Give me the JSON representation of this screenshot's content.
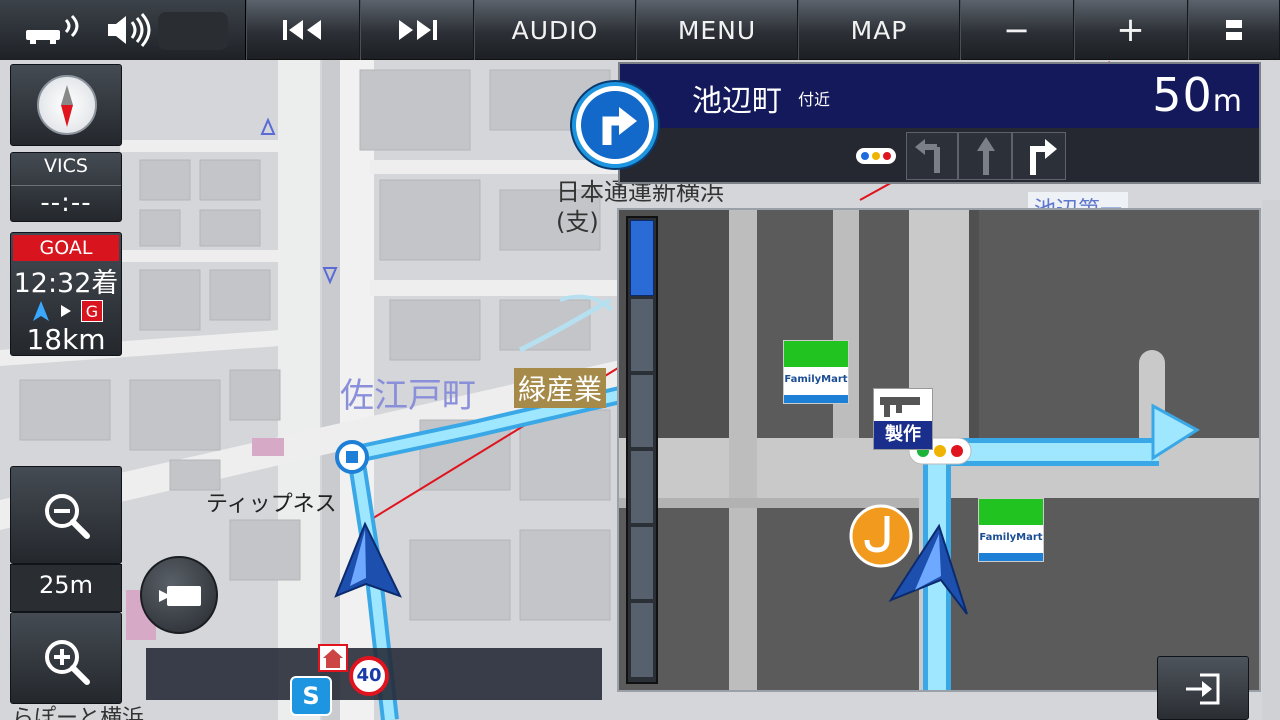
{
  "topbar": {
    "audio_label": "AUDIO",
    "menu_label": "MENU",
    "map_label": "MAP",
    "minus_label": "−",
    "plus_label": "+"
  },
  "left_panel": {
    "vics_label": "VICS",
    "vics_value": "--:--",
    "goal_label": "GOAL",
    "goal_time": "12:32着",
    "goal_marker": "G",
    "goal_distance": "18km",
    "scale_label": "25m"
  },
  "guidance": {
    "place": "池辺町",
    "near_label": "付近",
    "distance": "50",
    "distance_unit": "m"
  },
  "map_labels": {
    "area": "佐江戸町",
    "green_label": "緑産業",
    "company_line1": "日本通運新横浜",
    "company_line2": "(支)",
    "shop": "ティップネス",
    "bottom_left": "らぽーと横浜",
    "top_right_partial": "池辺第一"
  },
  "zoom_view": {
    "store1": "FamilyMart",
    "store2": "FamilyMart",
    "factory_label": "製作"
  },
  "speed_limit": "40",
  "parking_label": "S",
  "colors": {
    "route": "#7fd6ff",
    "guide_header": "#13195a",
    "goal_red": "#d8151f",
    "accent_blue": "#1e95e0"
  }
}
